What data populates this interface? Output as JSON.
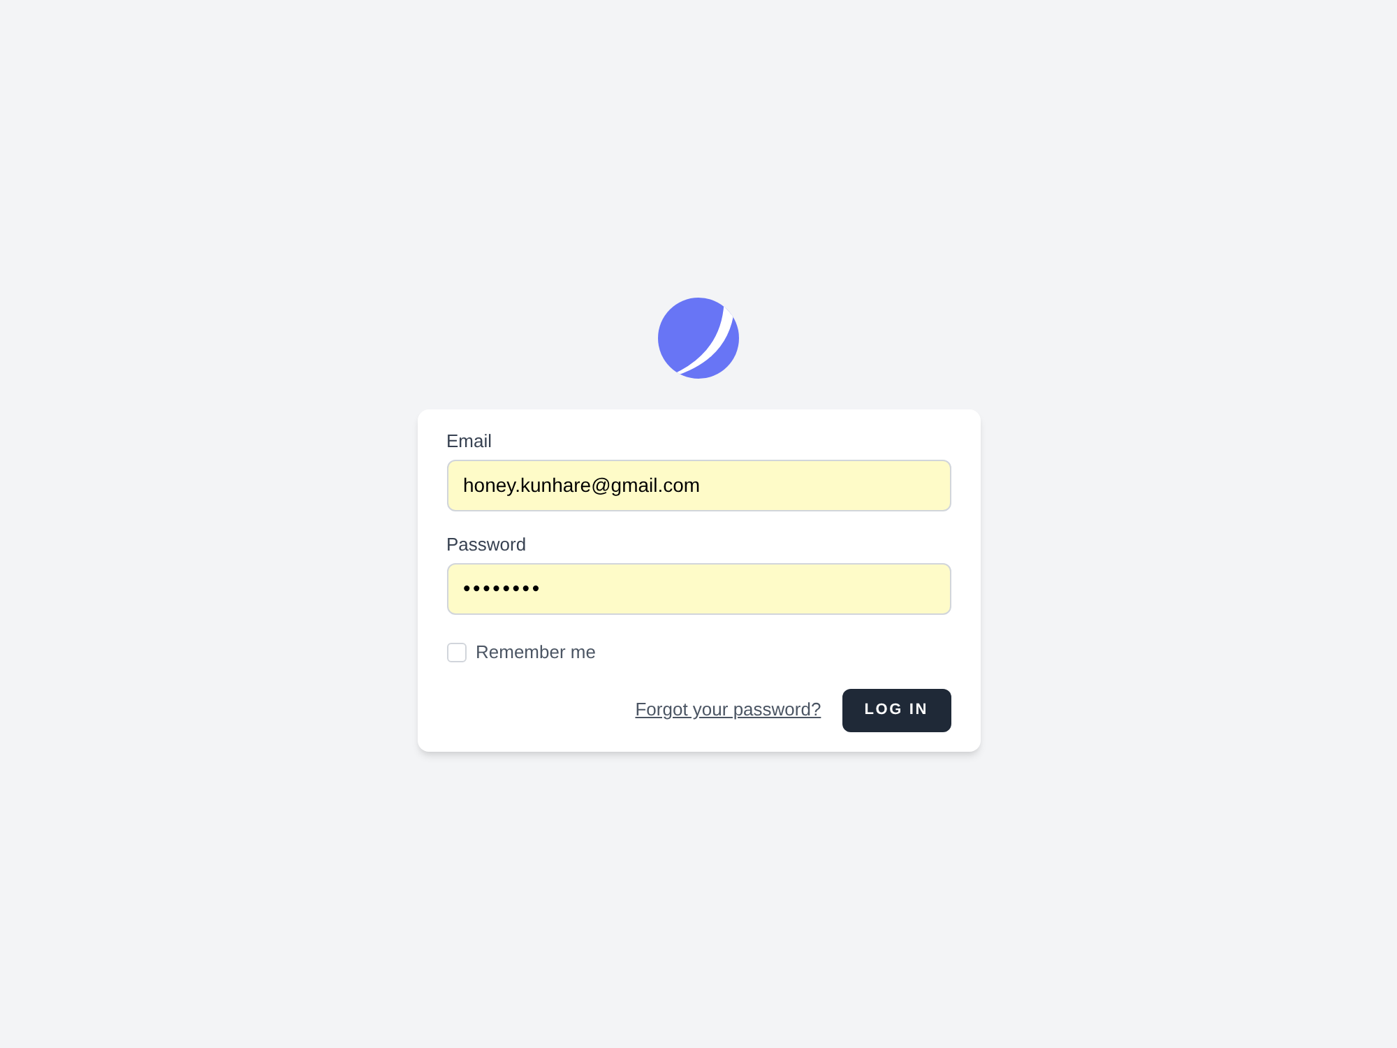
{
  "form": {
    "fields": [
      {
        "label": "Email",
        "value": "honey.kunhare@gmail.com",
        "kind": "text"
      },
      {
        "label": "Password",
        "value": "••••••••",
        "kind": "password"
      }
    ],
    "remember": {
      "label": "Remember me",
      "checked": false
    },
    "forgot_link": "Forgot your password?",
    "submit": "LOG IN"
  }
}
